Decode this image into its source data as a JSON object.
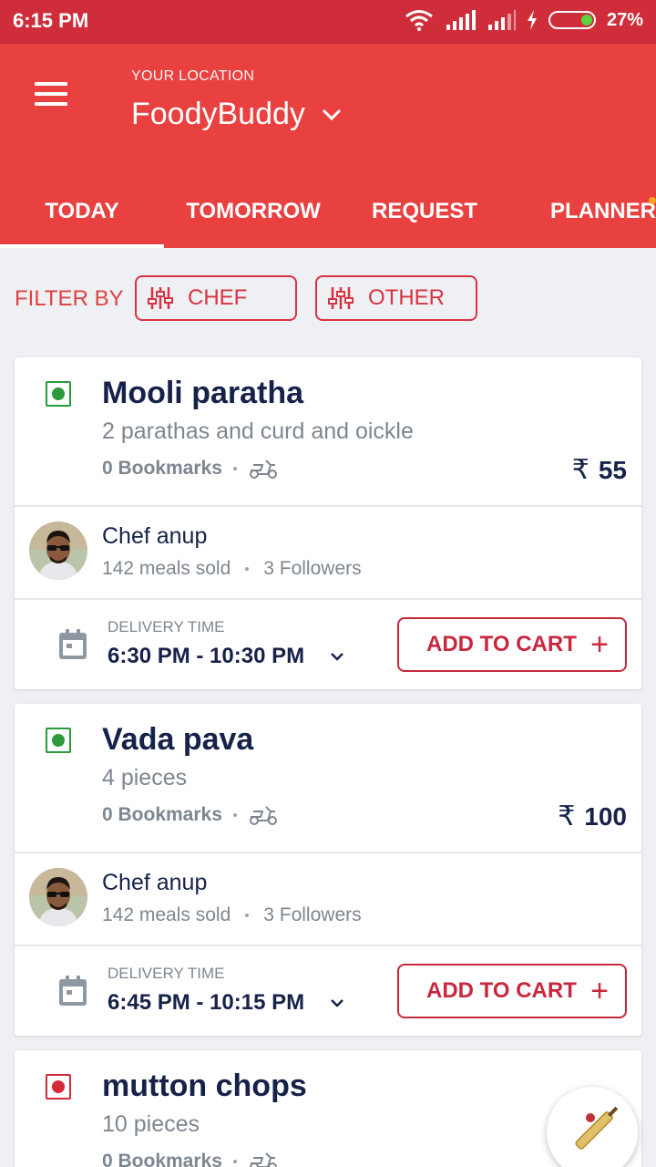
{
  "status": {
    "time": "6:15 PM",
    "battery": "27%"
  },
  "header": {
    "location_caption": "YOUR LOCATION",
    "location_name": "FoodyBuddy"
  },
  "tabs": [
    {
      "label": "TODAY"
    },
    {
      "label": "TOMORROW"
    },
    {
      "label": "REQUEST"
    },
    {
      "label": "PLANNER"
    }
  ],
  "filter": {
    "label": "FILTER BY",
    "chef_label": "CHEF",
    "other_label": "OTHER"
  },
  "meals": [
    {
      "title": "Mooli paratha",
      "description": "2 parathas and curd and oickle",
      "bookmarks": "0 Bookmarks",
      "currency": "₹",
      "price": "55",
      "chef": "Chef anup",
      "meals_sold": "142 meals sold",
      "followers": "3 Followers",
      "delivery_label": "DELIVERY TIME",
      "delivery_time": "6:30 PM - 10:30 PM",
      "cart_label": "ADD TO CART"
    },
    {
      "title": "Vada pava",
      "description": "4 pieces",
      "bookmarks": "0 Bookmarks",
      "currency": "₹",
      "price": "100",
      "chef": "Chef anup",
      "meals_sold": "142 meals sold",
      "followers": "3 Followers",
      "delivery_label": "DELIVERY TIME",
      "delivery_time": "6:45 PM - 10:15 PM",
      "cart_label": "ADD TO CART"
    },
    {
      "title": "mutton chops",
      "description": "10 pieces",
      "bookmarks": "0 Bookmarks"
    }
  ],
  "colors": {
    "brand": "#e94040",
    "status_bar": "#cf2d3a",
    "accent": "#c8283e",
    "veg": "#2a9a3a",
    "nonveg": "#d42a3a"
  }
}
